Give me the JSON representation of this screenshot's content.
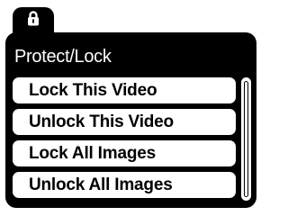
{
  "menu": {
    "tab_icon": "lock-icon",
    "title": "Protect/Lock",
    "items": [
      {
        "label": "Lock This Video"
      },
      {
        "label": "Unlock This Video"
      },
      {
        "label": "Lock All Images"
      },
      {
        "label": "Unlock All Images"
      }
    ]
  },
  "colors": {
    "panel": "#000000",
    "item_background": "#ffffff",
    "text_dark": "#000000",
    "text_light": "#ffffff"
  }
}
